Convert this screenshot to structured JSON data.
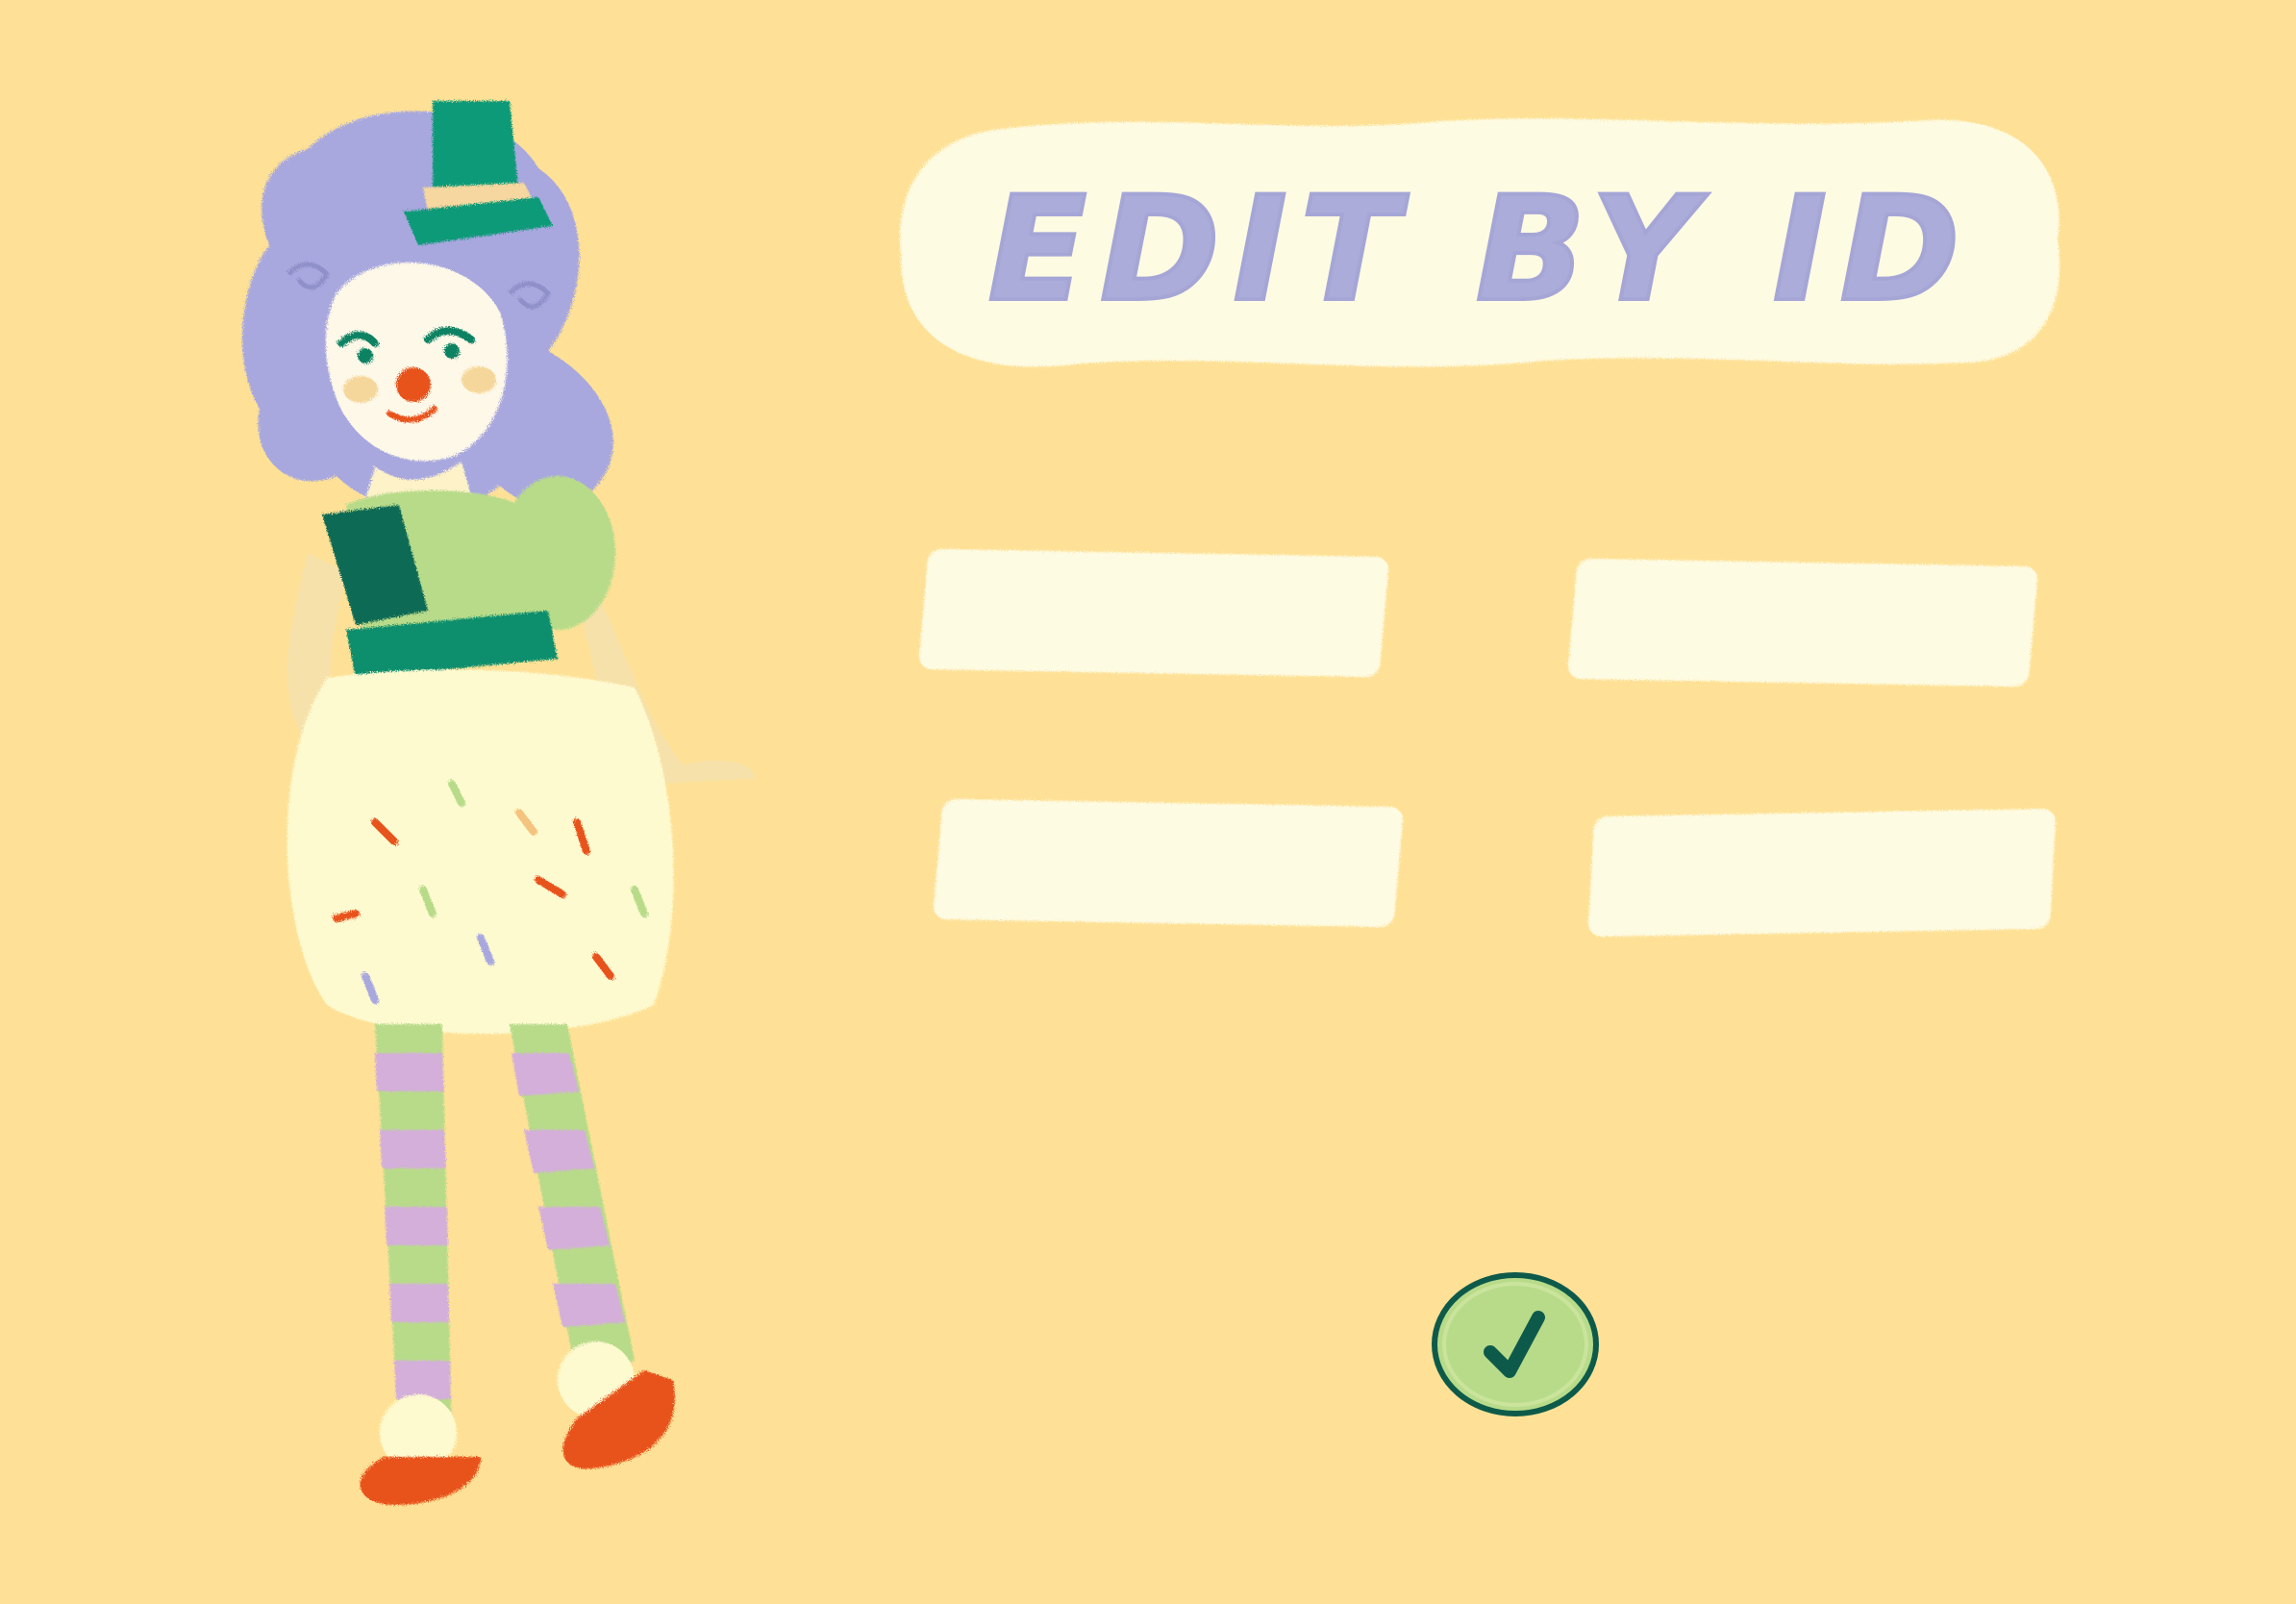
{
  "screen": {
    "title": "EDIT BY ID"
  },
  "form": {
    "fields": [
      {
        "value": "",
        "placeholder": ""
      },
      {
        "value": "",
        "placeholder": ""
      },
      {
        "value": "",
        "placeholder": ""
      },
      {
        "value": "",
        "placeholder": ""
      }
    ],
    "confirm_icon": "checkmark-icon"
  },
  "colors": {
    "background": "#FEE196",
    "title_text": "#ABACDA",
    "title_pill": "#FEFBE3",
    "field_fill": "#FEFBE3",
    "confirm_fill": "#B8DB8A",
    "confirm_outline": "#0E5A4A"
  },
  "illustration": {
    "name": "clown-character-illustration"
  }
}
